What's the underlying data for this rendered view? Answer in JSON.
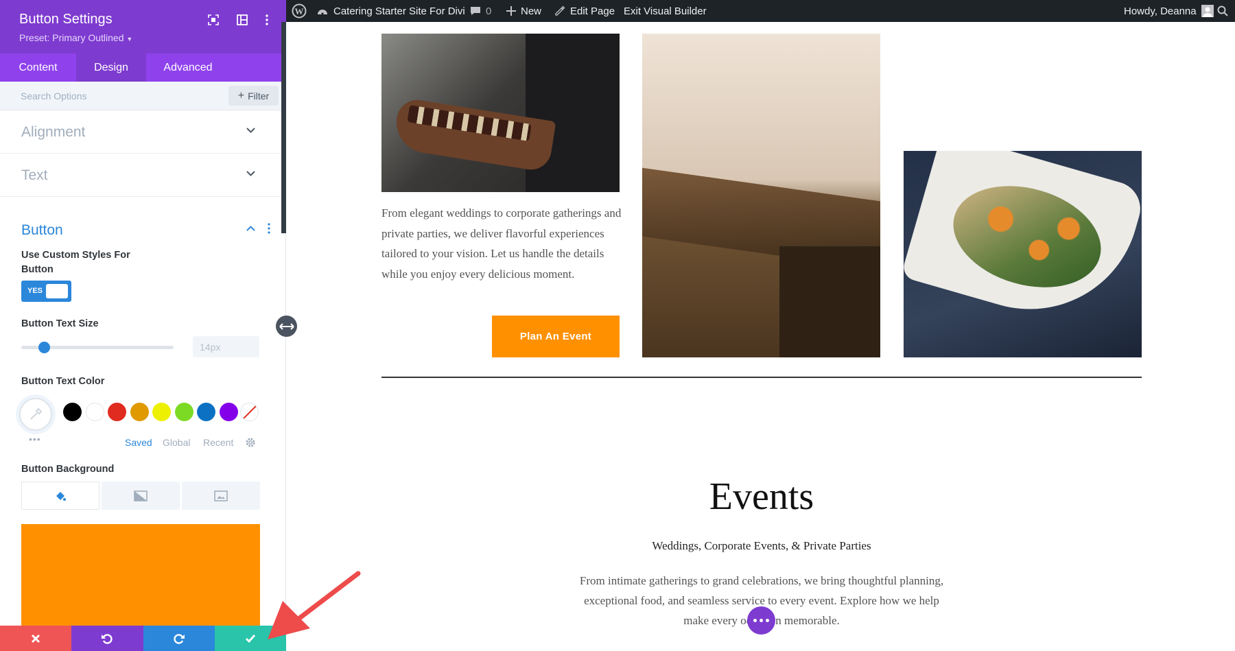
{
  "topbar": {
    "site_name": "Catering Starter Site For Divi",
    "comments": "0",
    "new": "New",
    "edit_page": "Edit Page",
    "exit_builder": "Exit Visual Builder",
    "greeting": "Howdy, Deanna"
  },
  "panel": {
    "title": "Button Settings",
    "preset": "Preset: Primary Outlined",
    "tabs": [
      "Content",
      "Design",
      "Advanced"
    ],
    "active_tab": "Design",
    "search_placeholder": "Search Options",
    "filter_label": "Filter",
    "sections": {
      "alignment": "Alignment",
      "text": "Text",
      "button": "Button"
    },
    "custom_styles_label": "Use Custom Styles For Button",
    "toggle_label": "YES",
    "text_size_label": "Button Text Size",
    "text_size_value": "14px",
    "text_size_fraction": 0.15,
    "text_color_label": "Button Text Color",
    "swatches": [
      "#000000",
      "#ffffff",
      "#e02b20",
      "#e09900",
      "#edf000",
      "#7cda24",
      "#0c71c3",
      "#8300e9"
    ],
    "palette_tabs": [
      "Saved",
      "Global",
      "Recent"
    ],
    "background_label": "Button Background",
    "background_color": "#ff9000"
  },
  "bottom_bar_colors": {
    "close": "#ef5555",
    "undo": "#7e3bd0",
    "redo": "#2b87da",
    "save": "#29c4a9"
  },
  "page": {
    "intro_text": "From elegant weddings to corporate gatherings and private parties, we deliver flavorful experiences tailored to your vision. Let us handle the details while you enjoy every delicious moment.",
    "cta_label": "Plan An Event",
    "cta_color": "#ff9000",
    "events_title": "Events",
    "events_subtitle": "Weddings, Corporate Events, & Private Parties",
    "events_desc": "From intimate gatherings to grand celebrations, we bring thoughtful planning, exceptional food, and seamless service to every event. Explore how we help make every occasion memorable."
  }
}
